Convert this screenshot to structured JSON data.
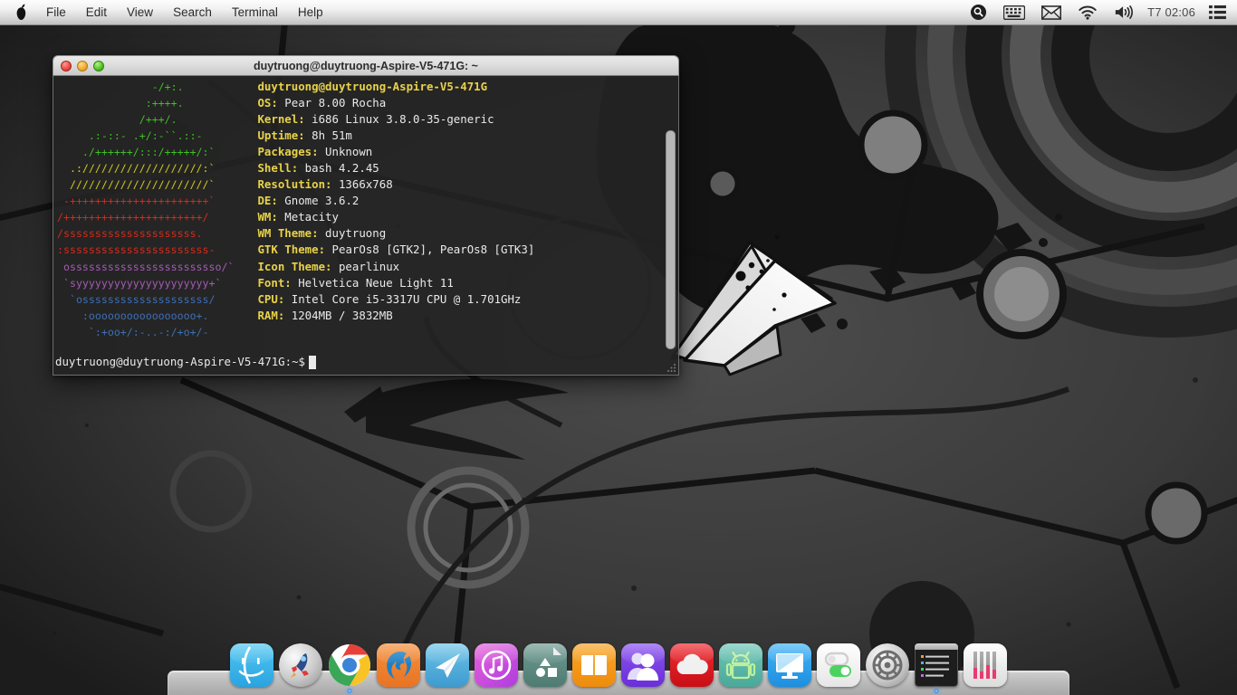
{
  "menubar": {
    "logo_icon": "pear-logo-icon",
    "items": [
      {
        "label": "File",
        "name": "menu-file"
      },
      {
        "label": "Edit",
        "name": "menu-edit"
      },
      {
        "label": "View",
        "name": "menu-view"
      },
      {
        "label": "Search",
        "name": "menu-search"
      },
      {
        "label": "Terminal",
        "name": "menu-terminal"
      },
      {
        "label": "Help",
        "name": "menu-help"
      }
    ],
    "status": {
      "search_icon": "search-icon",
      "keyboard_icon": "keyboard-icon",
      "mail_icon": "mail-icon",
      "wifi_icon": "wifi-icon",
      "volume_icon": "volume-icon",
      "clock": "T7 02:06",
      "menu_icon": "list-menu-icon"
    }
  },
  "window": {
    "title": "duytruong@duytruong-Aspire-V5-471G: ~",
    "buttons": {
      "close": "close-button",
      "minimize": "minimize-button",
      "maximize": "maximize-button"
    }
  },
  "terminal": {
    "userhost": "duytruong@duytruong-Aspire-V5-471G",
    "info": [
      {
        "key": "OS:",
        "value": "Pear 8.00 Rocha"
      },
      {
        "key": "Kernel:",
        "value": "i686 Linux 3.8.0-35-generic"
      },
      {
        "key": "Uptime:",
        "value": "8h 51m"
      },
      {
        "key": "Packages:",
        "value": "Unknown"
      },
      {
        "key": "Shell:",
        "value": "bash 4.2.45"
      },
      {
        "key": "Resolution:",
        "value": "1366x768"
      },
      {
        "key": "DE:",
        "value": "Gnome 3.6.2"
      },
      {
        "key": "WM:",
        "value": "Metacity"
      },
      {
        "key": "WM Theme:",
        "value": "duytruong"
      },
      {
        "key": "GTK Theme:",
        "value": "PearOs8 [GTK2], PearOs8 [GTK3]"
      },
      {
        "key": "Icon Theme:",
        "value": "pearlinux"
      },
      {
        "key": "Font:",
        "value": "Helvetica Neue Light 11"
      },
      {
        "key": "CPU:",
        "value": "Intel Core i5-3317U CPU @ 1.701GHz"
      },
      {
        "key": "RAM:",
        "value": "1204MB / 3832MB"
      }
    ],
    "prompt": "duytruong@duytruong-Aspire-V5-471G:~$",
    "ascii_art": [
      {
        "color": "green",
        "text": "               -/+:."
      },
      {
        "color": "green",
        "text": "              :++++."
      },
      {
        "color": "green",
        "text": "             /+++/."
      },
      {
        "color": "green",
        "text": "     .:-::- .+/:-``.::-"
      },
      {
        "color": "green",
        "text": "    ./++++++/:::/+++++/:`"
      },
      {
        "color": "yellow",
        "text": "  .:///////////////////:`"
      },
      {
        "color": "yellow",
        "text": "  //////////////////////`"
      },
      {
        "color": "red",
        "text": " -++++++++++++++++++++++`"
      },
      {
        "color": "red",
        "text": "/++++++++++++++++++++++/"
      },
      {
        "color": "red",
        "text": "/sssssssssssssssssssss."
      },
      {
        "color": "red",
        "text": ":sssssssssssssssssssssss-"
      },
      {
        "color": "purple",
        "text": " ossssssssssssssssssssssso/`"
      },
      {
        "color": "purple",
        "text": " `syyyyyyyyyyyyyyyyyyyyy+`"
      },
      {
        "color": "blue",
        "text": "  `ossssssssssssssssssss/"
      },
      {
        "color": "blue",
        "text": "    :ooooooooooooooooo+."
      },
      {
        "color": "blue",
        "text": "     `:+oo+/:-..-:/+o+/-"
      }
    ]
  },
  "dock": {
    "apps": [
      {
        "name": "dock-finder",
        "label": "Finder",
        "active": false
      },
      {
        "name": "dock-launchpad",
        "label": "Launchpad",
        "active": false
      },
      {
        "name": "dock-chrome",
        "label": "Google Chrome",
        "active": true
      },
      {
        "name": "dock-firefox",
        "label": "Firefox",
        "active": false
      },
      {
        "name": "dock-telegram",
        "label": "Telegram",
        "active": false
      },
      {
        "name": "dock-itunes",
        "label": "iTunes",
        "active": false
      },
      {
        "name": "dock-preview",
        "label": "Preview",
        "active": false
      },
      {
        "name": "dock-ibooks",
        "label": "iBooks",
        "active": false
      },
      {
        "name": "dock-contacts",
        "label": "Contacts",
        "active": false
      },
      {
        "name": "dock-icloud",
        "label": "iCloud",
        "active": false
      },
      {
        "name": "dock-android",
        "label": "Android",
        "active": false
      },
      {
        "name": "dock-displays",
        "label": "Displays",
        "active": false
      },
      {
        "name": "dock-toggles",
        "label": "Settings Toggle",
        "active": false
      },
      {
        "name": "dock-system-prefs",
        "label": "System Preferences",
        "active": false
      },
      {
        "name": "dock-terminal",
        "label": "Terminal",
        "active": true
      },
      {
        "name": "dock-system-monitor",
        "label": "System Monitor",
        "active": false
      }
    ]
  },
  "colors": {
    "menubar_bg": "#f2f2f2",
    "terminal_bg": "#242424",
    "accent_yellow": "#e8d24a",
    "ascii_green": "#3fbf24",
    "ascii_yellow": "#d4c81c",
    "ascii_red": "#d42b1c",
    "ascii_purple": "#a45bb5",
    "ascii_blue": "#3d6fb5",
    "desktop_bg": "#3a3a3a"
  }
}
